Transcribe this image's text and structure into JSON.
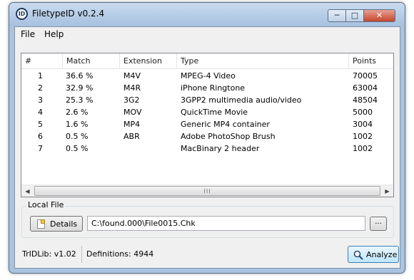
{
  "window": {
    "title": "FiletypeID v0.2.4",
    "app_icon_text": "ID",
    "minimize_glyph": "─",
    "maximize_glyph": "□",
    "close_glyph": "✕"
  },
  "menu": {
    "file": "File",
    "help": "Help"
  },
  "list": {
    "columns": {
      "num": "#",
      "match": "Match",
      "extension": "Extension",
      "type": "Type",
      "points": "Points"
    },
    "rows": [
      {
        "num": "1",
        "match": "36.6 %",
        "ext": "M4V",
        "type": "MPEG-4 Video",
        "points": "70005"
      },
      {
        "num": "2",
        "match": "32.9 %",
        "ext": "M4R",
        "type": "iPhone Ringtone",
        "points": "63004"
      },
      {
        "num": "3",
        "match": "25.3 %",
        "ext": "3G2",
        "type": "3GPP2 multimedia audio/video",
        "points": "48504"
      },
      {
        "num": "4",
        "match": "2.6 %",
        "ext": "MOV",
        "type": "QuickTime Movie",
        "points": "5000"
      },
      {
        "num": "5",
        "match": "1.6 %",
        "ext": "MP4",
        "type": "Generic MP4 container",
        "points": "3004"
      },
      {
        "num": "6",
        "match": "0.5 %",
        "ext": "ABR",
        "type": "Adobe PhotoShop Brush",
        "points": "1002"
      },
      {
        "num": "7",
        "match": "0.5 %",
        "ext": "",
        "type": "MacBinary 2 header",
        "points": "1002"
      }
    ],
    "scroll_left": "◀",
    "scroll_right": "▶",
    "scroll_grip": "III"
  },
  "local_file": {
    "group_label": "Local File",
    "details_label": "Details",
    "path_value": "C:\\found.000\\File0015.Chk",
    "browse_label": "..."
  },
  "status": {
    "trid_lib": "TrIDLib:  v1.02",
    "definitions": "Definitions:  4944",
    "analyze_label": "Analyze"
  }
}
